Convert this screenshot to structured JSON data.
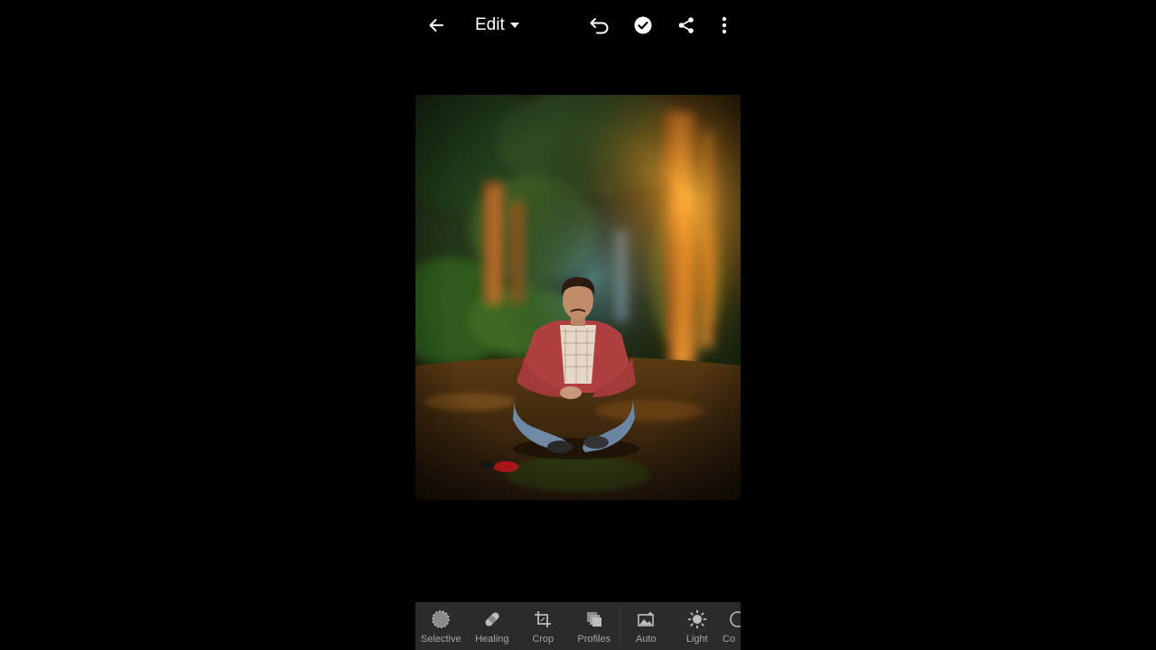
{
  "header": {
    "mode_label": "Edit"
  },
  "toolbar": {
    "tools": [
      {
        "label": "Selective",
        "icon": "selective-icon"
      },
      {
        "label": "Healing",
        "icon": "healing-icon"
      },
      {
        "label": "Crop",
        "icon": "crop-icon"
      },
      {
        "label": "Profiles",
        "icon": "profiles-icon"
      },
      {
        "label": "Auto",
        "icon": "auto-icon"
      },
      {
        "label": "Light",
        "icon": "light-icon"
      },
      {
        "label": "Co",
        "icon": "color-icon"
      }
    ]
  },
  "colors": {
    "background": "#000000",
    "toolbar_bg": "#2b2b2b",
    "toolbar_label": "#a6a6a6",
    "icon": "#ffffff"
  }
}
